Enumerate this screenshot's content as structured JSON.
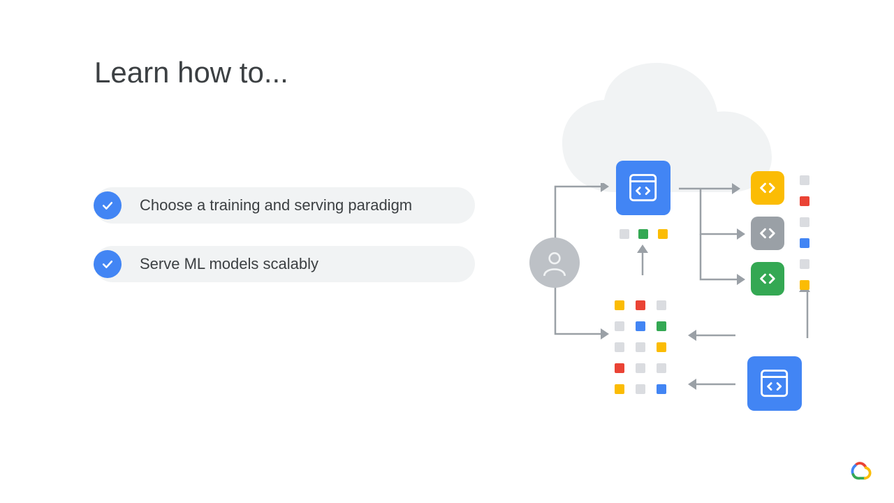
{
  "title": "Learn how to...",
  "bullets": [
    {
      "text": "Choose a training and serving paradigm"
    },
    {
      "text": "Serve ML models scalably"
    }
  ],
  "diagram": {
    "icons": {
      "cloud": "cloud-shape",
      "user": "user-avatar",
      "code_blue_large_top": "code-icon",
      "code_blue_large_bottom": "code-icon",
      "code_yellow": "code-icon",
      "code_grey": "code-icon",
      "code_green": "code-icon"
    },
    "colors": {
      "blue": "#4285f4",
      "red": "#ea4335",
      "yellow": "#fbbc04",
      "green": "#34a853",
      "grey_light": "#dadce0",
      "grey_mid": "#9aa0a6",
      "grey_dark": "#bdc1c6"
    }
  },
  "branding": {
    "logo": "google-cloud-logo"
  }
}
